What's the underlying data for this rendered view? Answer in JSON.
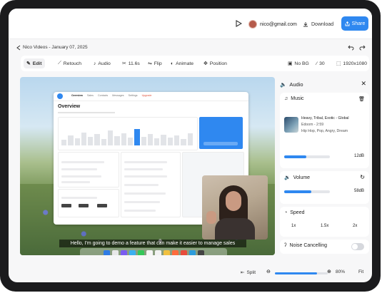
{
  "header": {
    "user_email": "nico@gmail.com",
    "download_label": "Download",
    "share_label": "Share"
  },
  "project": {
    "title": "Nico Videos - January 07, 2025"
  },
  "toolbar": {
    "edit": "Edit",
    "retouch": "Retouch",
    "audio": "Audio",
    "duration": "11.6s",
    "flip": "Flip",
    "animate": "Animate",
    "position": "Position",
    "no_bg": "No BG",
    "fps": "30",
    "resolution": "1920x1080"
  },
  "canvas": {
    "subtitle": "Hello, I'm going to demo a feature that can make it easier to manage sales",
    "app": {
      "title": "Overview",
      "tabs": [
        "Overview",
        "Sales",
        "Contacts",
        "Messages",
        "Settings"
      ],
      "badge": "Upgrade"
    }
  },
  "panel": {
    "title": "Audio",
    "music": {
      "label": "Music",
      "track_title": "Heavy, Tribal, Exotic - Global",
      "track_meta": "Edoom - 2:59",
      "track_tags": "Hip Hop, Pop, Angry, Dream",
      "level": "12dB",
      "level_fraction": 0.48
    },
    "volume": {
      "label": "Volume",
      "level": "58dB",
      "level_fraction": 0.6
    },
    "speed": {
      "label": "Speed",
      "options": [
        "1x",
        "1.5x",
        "2x"
      ]
    },
    "noise_cancelling": {
      "label": "Noise Cancelling",
      "enabled": false
    }
  },
  "footer": {
    "split_label": "Split",
    "zoom": "80%",
    "zoom_fraction": 0.8,
    "fit_label": "Fit"
  },
  "colors": {
    "accent": "#2f88f0",
    "frame": "#1b1b1d"
  }
}
